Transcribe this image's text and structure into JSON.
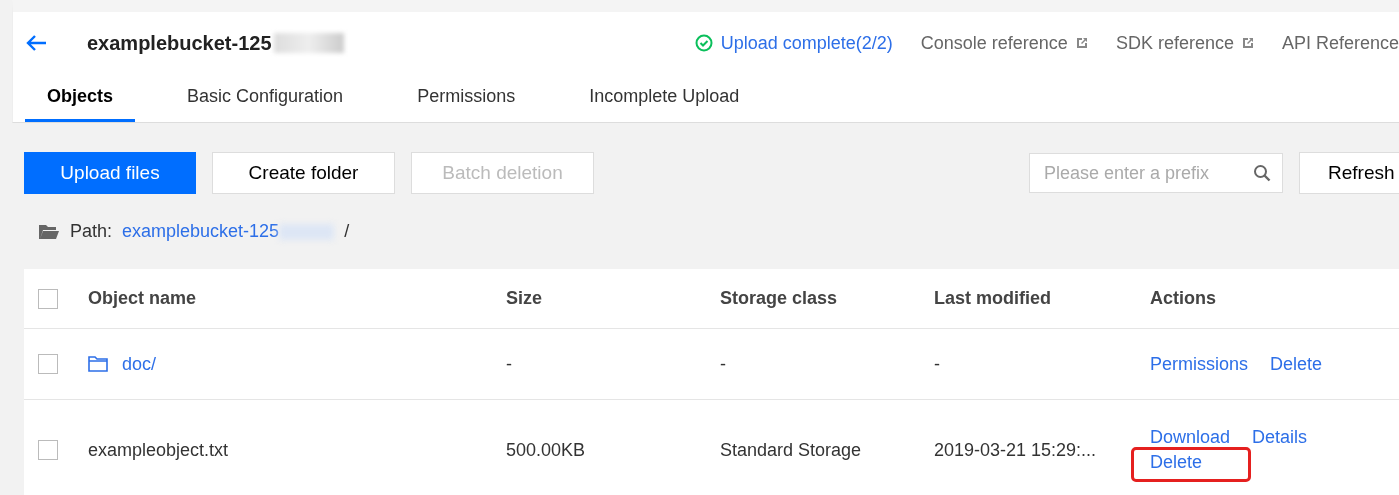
{
  "header": {
    "title": "examplebucket-125",
    "status": "Upload complete(2/2)",
    "links": [
      {
        "label": "Console reference",
        "external": true
      },
      {
        "label": "SDK reference",
        "external": true
      },
      {
        "label": "API Reference",
        "external": false
      }
    ]
  },
  "tabs": [
    {
      "label": "Objects",
      "selected": true
    },
    {
      "label": "Basic Configuration",
      "selected": false
    },
    {
      "label": "Permissions",
      "selected": false
    },
    {
      "label": "Incomplete Upload",
      "selected": false
    }
  ],
  "toolbar": {
    "buttons": [
      {
        "label": "Upload files",
        "kind": "primary",
        "disabled": false
      },
      {
        "label": "Create folder",
        "kind": "default",
        "disabled": false
      },
      {
        "label": "Batch deletion",
        "kind": "default",
        "disabled": true
      }
    ],
    "search": {
      "placeholder": "Please enter a prefix"
    },
    "refresh": "Refresh"
  },
  "path": {
    "label": "Path:",
    "bucket": "examplebucket-125",
    "separator": "/"
  },
  "table": {
    "header_checked": false,
    "columns": [
      "Object name",
      "Size",
      "Storage class",
      "Last modified",
      "Actions"
    ],
    "rows": [
      {
        "kind": "folder",
        "checked": false,
        "name": "doc/",
        "size": "-",
        "storage_class": "-",
        "last_modified": "-",
        "actions": [
          {
            "label": "Permissions",
            "highlighted": false
          },
          {
            "label": "Delete",
            "highlighted": false
          }
        ]
      },
      {
        "kind": "file",
        "checked": false,
        "name": "exampleobject.txt",
        "size": "500.00KB",
        "storage_class": "Standard Storage",
        "last_modified": "2019-03-21 15:29:...",
        "actions": [
          {
            "label": "Download",
            "highlighted": false
          },
          {
            "label": "Details",
            "highlighted": false
          },
          {
            "label": "Delete",
            "highlighted": true
          }
        ]
      }
    ]
  }
}
